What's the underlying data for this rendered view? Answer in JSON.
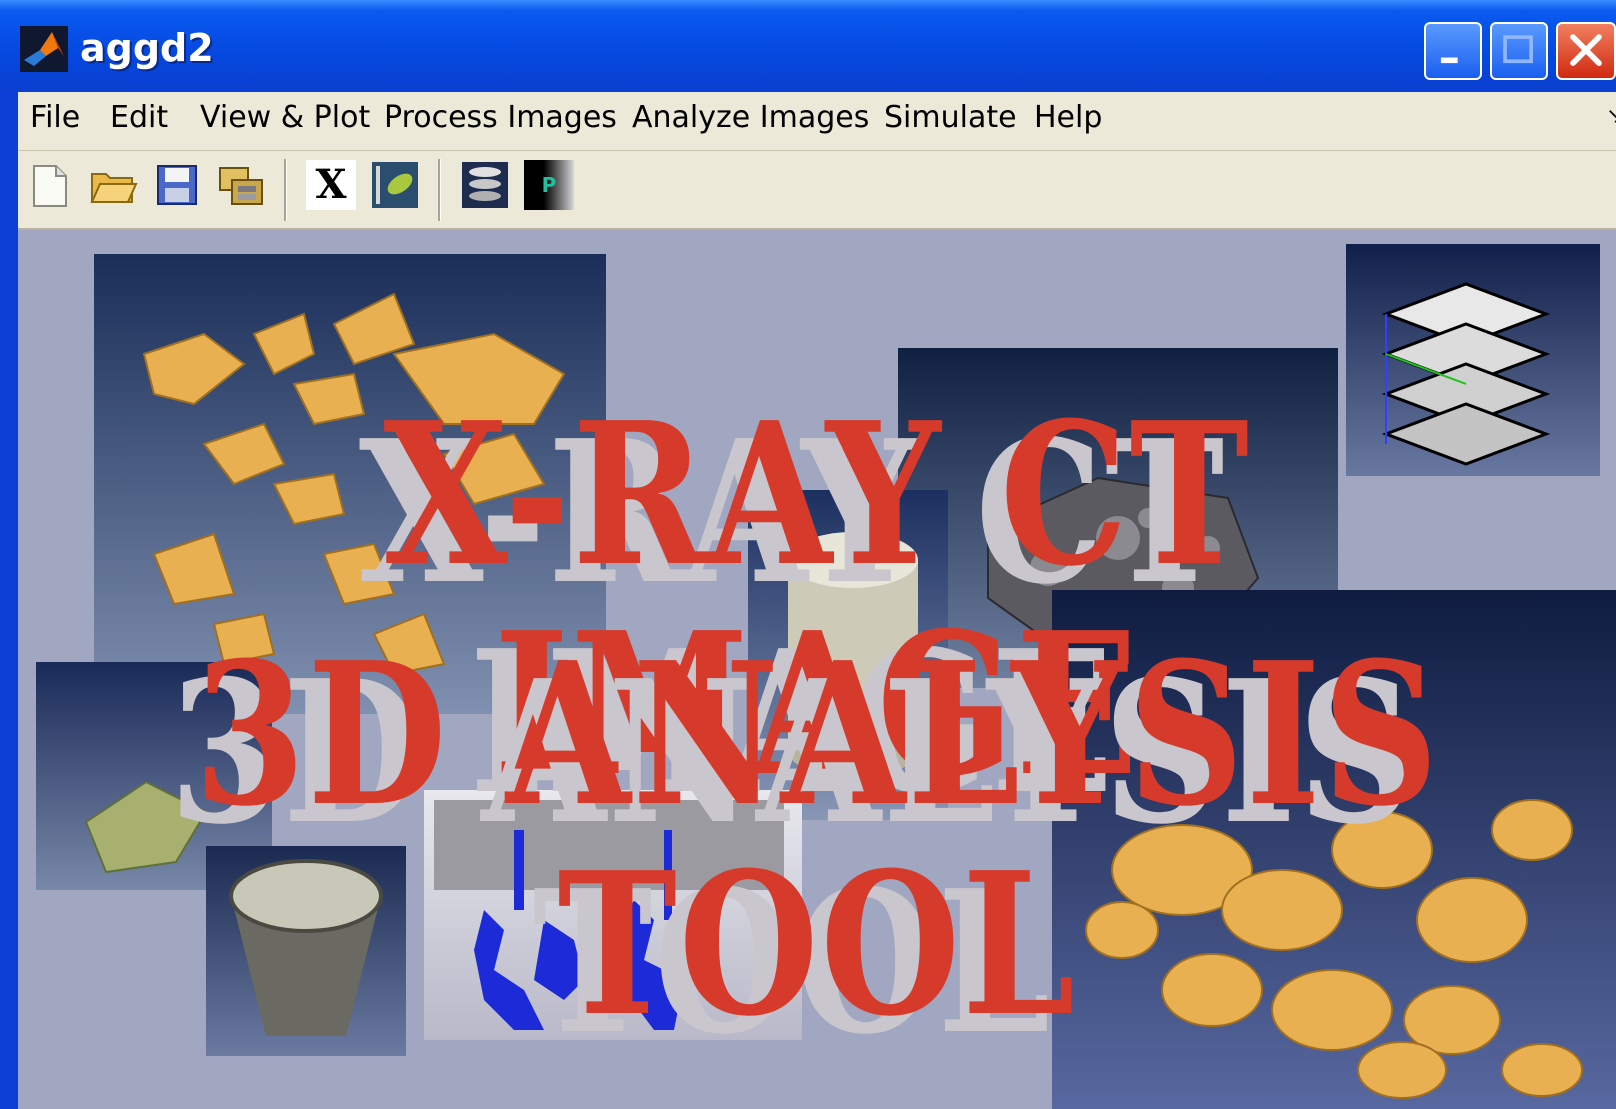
{
  "window": {
    "title": "aggd2"
  },
  "menu": {
    "items": [
      "File",
      "Edit",
      "View & Plot",
      "Process Images",
      "Analyze Images",
      "Simulate",
      "Help"
    ]
  },
  "toolbar": {
    "tools": [
      "new-file",
      "open-folder",
      "save",
      "export",
      "x-tool",
      "picture-tool",
      "layers-tool",
      "p-tool"
    ],
    "p_label": "P",
    "x_label": "X"
  },
  "banner": {
    "line1": "X-RAY CT IMAGE",
    "line2": "3D ANALYSIS TOOL",
    "text_color": "#d63a2a",
    "shadow_color": "#c9c7cd"
  },
  "colors": {
    "canvas_bg": "#a1a7c0",
    "titlebar": "#0548e0"
  }
}
